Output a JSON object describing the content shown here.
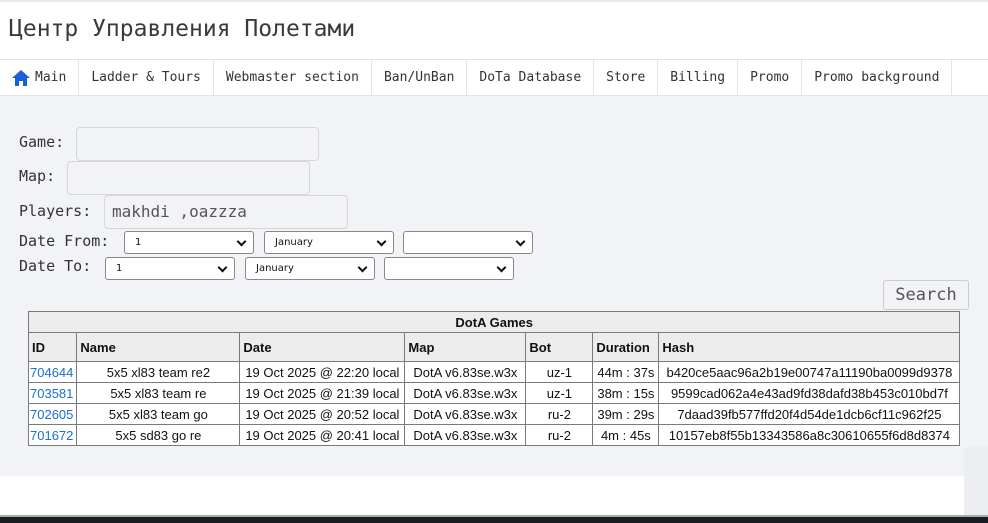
{
  "header": {
    "title": "Центр Управления Полетами"
  },
  "nav": [
    {
      "label": "Main",
      "icon": "home-icon"
    },
    {
      "label": "Ladder & Tours"
    },
    {
      "label": "Webmaster section"
    },
    {
      "label": "Ban/UnBan"
    },
    {
      "label": "DoTa Database"
    },
    {
      "label": "Store"
    },
    {
      "label": "Billing"
    },
    {
      "label": "Promo"
    },
    {
      "label": "Promo background"
    }
  ],
  "form": {
    "game_label": "Game:",
    "game_value": "",
    "map_label": "Map:",
    "map_value": "",
    "players_label": "Players:",
    "players_value": "makhdi ,oazzza",
    "date_from_label": "Date From:",
    "date_from": {
      "day": "1",
      "month": "January",
      "year": ""
    },
    "date_to_label": "Date To:",
    "date_to": {
      "day": "1",
      "month": "January",
      "year": ""
    },
    "search_label": "Search"
  },
  "table": {
    "caption": "DotA Games",
    "columns": [
      "ID",
      "Name",
      "Date",
      "Map",
      "Bot",
      "Duration",
      "Hash"
    ],
    "rows": [
      [
        "704644",
        "5x5 xl83 team re2",
        "19 Oct 2025 @ 22:20 local",
        "DotA v6.83se.w3x",
        "uz-1",
        "44m : 37s",
        "b420ce5aac96a2b19e00747a11190ba0099d9378"
      ],
      [
        "703581",
        "5x5 xl83 team re",
        "19 Oct 2025 @ 21:39 local",
        "DotA v6.83se.w3x",
        "uz-1",
        "38m : 15s",
        "9599cad062a4e43ad9fd38dafd38b453c010bd7f"
      ],
      [
        "702605",
        "5x5 xl83 team go",
        "19 Oct 2025 @ 20:52 local",
        "DotA v6.83se.w3x",
        "ru-2",
        "39m : 29s",
        "7daad39fb577ffd20f4d54de1dcb6cf11c962f25"
      ],
      [
        "701672",
        "5x5 sd83 go re",
        "19 Oct 2025 @ 20:41 local",
        "DotA v6.83se.w3x",
        "ru-2",
        "4m : 45s",
        "10157eb8f55b13343586a8c30610655f6d8d8374"
      ]
    ]
  },
  "colors": {
    "link": "#1a6fcf",
    "panel": "#f2f3f6"
  }
}
